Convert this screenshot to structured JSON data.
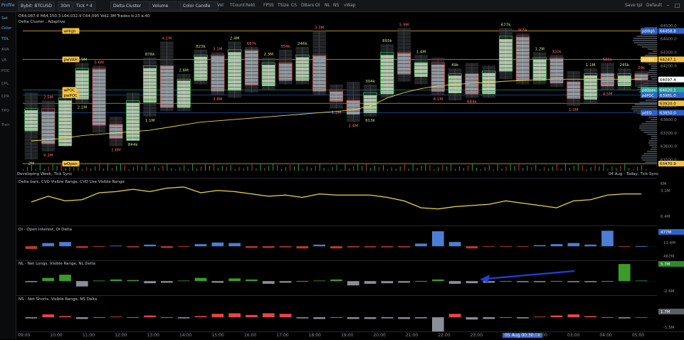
{
  "toolbar": {
    "tab": "Profile",
    "symbol": "Bybit: BTCUSD",
    "timeframe": "30m",
    "tick": "Tick * 4",
    "chart_type": "Delta Cluster",
    "volume": "Volume",
    "candle": "Color Candle",
    "buttons": [
      "Vol",
      "TCount",
      "Rekt",
      "FPSS",
      "TSize",
      "CS",
      "DBars",
      "OI",
      "NL",
      "NS",
      "vWap"
    ],
    "save": "Save tpl",
    "default": "Default"
  },
  "sidebar": [
    "Set",
    "Color",
    "TDL",
    "AVA",
    "VA",
    "POC",
    "CPL",
    "CPR",
    "TPO",
    "Tren"
  ],
  "ohlc": "O64,087.6 H64,150.3 L64,032.9 C64,095",
  "ohlc_extra": "Vol2.3M Trades b:23 a:40",
  "main_title": "Delta Cluster , Adaptive",
  "main_yaxis": [
    "64500.0",
    "64400.0",
    "64300.0",
    "64200.0",
    "64100.0",
    "64000.0",
    "63900.0",
    "63800.0",
    "63700.0",
    "63600.0",
    "63500.0"
  ],
  "price_tags": [
    {
      "label": "pdHigh",
      "value": "64458.8",
      "color": "#2d63c9"
    },
    {
      "label": "pdVAH",
      "value": "64247.1",
      "color": "#f5c242"
    },
    {
      "label": "",
      "value": "64097.4",
      "color": "#ffffff"
    },
    {
      "label": "pdOpen",
      "value": "64020.1",
      "color": "#26a69a"
    },
    {
      "label": "pdPOC",
      "value": "63981.0",
      "color": "#2d63c9"
    },
    {
      "label": "",
      "value": "63920.0",
      "color": "#f5c242"
    },
    {
      "label": "pdEQ",
      "value": "63850.0",
      "color": "#2d63c9"
    },
    {
      "label": "",
      "value": "63470.9",
      "color": "#f5c242"
    }
  ],
  "level_labels": [
    "wHigh",
    "pwVAH",
    "wPOC",
    "pwPOC",
    "wOpen"
  ],
  "session": {
    "left": "Developing Week, Tick Sync",
    "right": "04 Aug - Today, Tick Sync"
  },
  "cvd": {
    "title": "Delta bars, CVD Visible Range, CVD Use Visible Range",
    "axis": [
      "6M",
      "3.1M",
      "6.4M"
    ]
  },
  "oi": {
    "title": "OI - Open Interest, OI Delta",
    "axis": [
      "11.6M",
      "467M"
    ],
    "tag": "477M"
  },
  "nl": {
    "title": "NL - Net Longs, Visible Range, NL Delta",
    "axis": [
      "-2.6M"
    ],
    "tag": "5.7M"
  },
  "ns": {
    "title": "NS - Net Shorts, Visible Range, NS Delta",
    "axis": [
      "-1.5M"
    ],
    "tag": "1.7M"
  },
  "xaxis": [
    "09:00",
    "10:00",
    "11:00",
    "12:00",
    "13:00",
    "14:00",
    "15:00",
    "16:00",
    "17:00",
    "18:00",
    "19:00",
    "20:00",
    "21:00",
    "22:00",
    "23:00",
    "05 Aug 00:30:00",
    "02:00",
    "03:00",
    "04:00",
    "05:00"
  ],
  "chart_data": {
    "type": "bar",
    "title": "Delta Cluster , Adaptive",
    "candles": [
      {
        "o": 63720,
        "h": 64000,
        "l": 63500,
        "c": 63880,
        "label_top": "",
        "label_bot": "2M"
      },
      {
        "o": 63880,
        "h": 63940,
        "l": 63560,
        "c": 63620,
        "label_top": "2.5M",
        "label_bot": "9.2M"
      },
      {
        "o": 63620,
        "h": 64020,
        "l": 63600,
        "c": 63960,
        "label_top": "",
        "label_bot": ""
      },
      {
        "o": 63960,
        "h": 64220,
        "l": 63920,
        "c": 64180,
        "label_top": "3.9M",
        "label_bot": "2.1M"
      },
      {
        "o": 64180,
        "h": 64200,
        "l": 63700,
        "c": 63760,
        "label_top": "5.6M",
        "label_bot": ""
      },
      {
        "o": 63760,
        "h": 63820,
        "l": 63600,
        "c": 63660,
        "label_top": "",
        "label_bot": "1.8M"
      },
      {
        "o": 63660,
        "h": 64000,
        "l": 63640,
        "c": 63940,
        "label_top": "",
        "label_bot": "844k"
      },
      {
        "o": 63940,
        "h": 64260,
        "l": 63820,
        "c": 64200,
        "label_top": "876k",
        "label_bot": "1.1M"
      },
      {
        "o": 64200,
        "h": 64380,
        "l": 63860,
        "c": 63900,
        "label_top": "4.1M",
        "label_bot": ""
      },
      {
        "o": 63900,
        "h": 64140,
        "l": 63860,
        "c": 64100,
        "label_top": "2.6M",
        "label_bot": ""
      },
      {
        "o": 64100,
        "h": 64320,
        "l": 64060,
        "c": 64280,
        "label_top": "823k",
        "label_bot": ""
      },
      {
        "o": 64280,
        "h": 64300,
        "l": 63980,
        "c": 64020,
        "label_top": "3.1M",
        "label_bot": "3.8M"
      },
      {
        "o": 64020,
        "h": 64380,
        "l": 63960,
        "c": 64320,
        "label_top": "2.4M",
        "label_bot": ""
      },
      {
        "o": 64320,
        "h": 64340,
        "l": 64000,
        "c": 64060,
        "label_top": "687k",
        "label_bot": ""
      },
      {
        "o": 64060,
        "h": 64260,
        "l": 64020,
        "c": 64220,
        "label_top": "2.3M",
        "label_bot": ""
      },
      {
        "o": 64220,
        "h": 64320,
        "l": 64060,
        "c": 64100,
        "label_top": "354k",
        "label_bot": ""
      },
      {
        "o": 64100,
        "h": 64340,
        "l": 64060,
        "c": 64280,
        "label_top": "246k",
        "label_bot": ""
      },
      {
        "o": 64280,
        "h": 64460,
        "l": 63980,
        "c": 64020,
        "label_top": "3.3M",
        "label_bot": ""
      },
      {
        "o": 64020,
        "h": 64060,
        "l": 63880,
        "c": 63940,
        "label_top": "",
        "label_bot": "1.2M"
      },
      {
        "o": 63940,
        "h": 64080,
        "l": 63780,
        "c": 63860,
        "label_top": "",
        "label_bot": "2.4M"
      },
      {
        "o": 63860,
        "h": 64060,
        "l": 63820,
        "c": 64000,
        "label_top": "304k",
        "label_bot": "613k"
      },
      {
        "o": 64000,
        "h": 64360,
        "l": 63960,
        "c": 64300,
        "label_top": "893k",
        "label_bot": ""
      },
      {
        "o": 64300,
        "h": 64480,
        "l": 64080,
        "c": 64140,
        "label_top": "5.9M",
        "label_bot": ""
      },
      {
        "o": 64140,
        "h": 64280,
        "l": 64060,
        "c": 64220,
        "label_top": "1.4M",
        "label_bot": ""
      },
      {
        "o": 64220,
        "h": 64260,
        "l": 63980,
        "c": 64020,
        "label_top": "",
        "label_bot": "4.1M"
      },
      {
        "o": 64020,
        "h": 64180,
        "l": 63940,
        "c": 64140,
        "label_top": "49k",
        "label_bot": ""
      },
      {
        "o": 64140,
        "h": 64220,
        "l": 63960,
        "c": 64000,
        "label_top": "",
        "label_bot": "684k"
      },
      {
        "o": 64000,
        "h": 64200,
        "l": 63960,
        "c": 64160,
        "label_top": "",
        "label_bot": ""
      },
      {
        "o": 64160,
        "h": 64480,
        "l": 64100,
        "c": 64420,
        "label_top": "677k",
        "label_bot": ""
      },
      {
        "o": 64420,
        "h": 64440,
        "l": 64060,
        "c": 64100,
        "label_top": "905k",
        "label_bot": ""
      },
      {
        "o": 64100,
        "h": 64300,
        "l": 64060,
        "c": 64260,
        "label_top": "1.2M",
        "label_bot": ""
      },
      {
        "o": 64260,
        "h": 64280,
        "l": 64040,
        "c": 64080,
        "label_top": "320k",
        "label_bot": ""
      },
      {
        "o": 64080,
        "h": 64160,
        "l": 63900,
        "c": 63960,
        "label_top": "",
        "label_bot": "1.2M"
      },
      {
        "o": 63960,
        "h": 64180,
        "l": 63920,
        "c": 64140,
        "label_top": "1.1M",
        "label_bot": ""
      },
      {
        "o": 64140,
        "h": 64220,
        "l": 64020,
        "c": 64060,
        "label_top": "581k",
        "label_bot": "4.5M"
      },
      {
        "o": 64060,
        "h": 64180,
        "l": 64020,
        "c": 64140,
        "label_top": "245k",
        "label_bot": ""
      },
      {
        "o": 64140,
        "h": 64160,
        "l": 64040,
        "c": 64095,
        "label_top": "29k",
        "label_bot": ""
      }
    ],
    "vwap": [
      63640,
      63650,
      63660,
      63680,
      63690,
      63700,
      63710,
      63720,
      63740,
      63760,
      63780,
      63790,
      63800,
      63810,
      63820,
      63830,
      63840,
      63850,
      63860,
      63870,
      63900,
      63960,
      64000,
      64030,
      64050,
      64060,
      64070,
      64075,
      64085,
      64090,
      64095,
      64100,
      64100,
      64100,
      64100,
      64100,
      64100
    ],
    "cvd_line": [
      3.2,
      4.2,
      3.4,
      3.6,
      4.8,
      5.0,
      5.4,
      5.0,
      5.6,
      5.8,
      4.8,
      5.2,
      5.0,
      4.6,
      4.2,
      4.4,
      4.0,
      4.6,
      4.4,
      4.4,
      4.4,
      4.0,
      3.4,
      2.2,
      2.0,
      2.4,
      2.6,
      2.8,
      3.4,
      3.0,
      2.6,
      2.2,
      3.4,
      3.6,
      4.4,
      4.6,
      4.6
    ],
    "oi_values": [
      -0.5,
      0.6,
      0.8,
      -0.3,
      -0.1,
      0.1,
      -0.2,
      0.3,
      -0.3,
      -0.1,
      0.4,
      0.7,
      0.6,
      -0.3,
      -0.3,
      -0.2,
      -0.4,
      0.3,
      -0.4,
      -0.2,
      -0.2,
      -0.2,
      -0.2,
      0.5,
      2.8,
      0.8,
      -0.4,
      -0.1,
      -0.1,
      -0.1,
      0.2,
      0.4,
      0.6,
      0.3,
      2.9,
      -0.1,
      0
    ],
    "nl_values": [
      -0.2,
      0.6,
      1.2,
      -1.0,
      0.1,
      0.3,
      0.2,
      -0.4,
      -0.3,
      0.1,
      0.6,
      -0.3,
      0.5,
      0.3,
      -0.5,
      -0.3,
      -0.1,
      0.1,
      0.3,
      -0.8,
      -0.5,
      -0.4,
      -0.3,
      -0.1,
      0.3,
      -0.5,
      -0.4,
      -0.3,
      -0.1,
      -0.2,
      -0.2,
      -0.1,
      -0.2,
      -0.2,
      -0.1,
      3.2,
      0.1
    ],
    "ns_values": [
      -0.2,
      0.5,
      0.2,
      -0.3,
      -0.1,
      0.1,
      -0.1,
      0.3,
      -0.1,
      -0.2,
      0.2,
      0.6,
      0.7,
      0.4,
      0.7,
      0.6,
      -0.2,
      -0.3,
      -0.1,
      -0.3,
      -0.3,
      -0.2,
      -0.3,
      -0.2,
      -2.8,
      0.6,
      -0.4,
      -0.3,
      -0.1,
      -0.2,
      0.1,
      0.3,
      0.5,
      0.2,
      -0.1,
      -0.2,
      0
    ],
    "ylim": [
      63450,
      64520
    ]
  }
}
